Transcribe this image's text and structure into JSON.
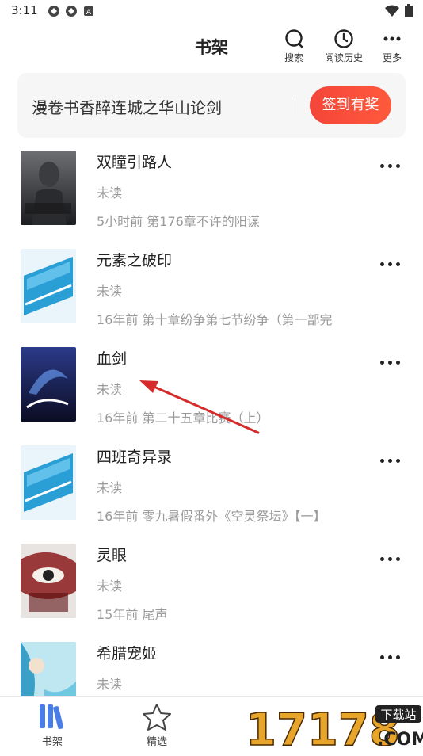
{
  "status_bar": {
    "time": "3:11"
  },
  "header": {
    "title": "书架",
    "actions": [
      {
        "label": "搜索",
        "icon": "search-icon"
      },
      {
        "label": "阅读历史",
        "icon": "clock-icon"
      },
      {
        "label": "更多",
        "icon": "more-icon"
      }
    ]
  },
  "banner": {
    "text": "漫卷书香醉连城之华山论剑",
    "button": "签到有奖"
  },
  "books": [
    {
      "title": "双瞳引路人",
      "status": "未读",
      "update": "5小时前 第176章不许的阳谋"
    },
    {
      "title": "元素之破印",
      "status": "未读",
      "update": "16年前 第十章纷争第七节纷争（第一部完"
    },
    {
      "title": "血剑",
      "status": "未读",
      "update": "16年前 第二十五章比赛（上）"
    },
    {
      "title": "四班奇异录",
      "status": "未读",
      "update": "16年前 零九暑假番外《空灵祭坛》【一】"
    },
    {
      "title": "灵眼",
      "status": "未读",
      "update": "15年前 尾声"
    },
    {
      "title": "希腊宠姬",
      "status": "未读",
      "update": ""
    }
  ],
  "tabbar": {
    "tabs": [
      {
        "label": "书架",
        "icon": "bookshelf-icon"
      },
      {
        "label": "精选",
        "icon": "star-icon"
      }
    ]
  },
  "watermark": {
    "text": "17178",
    "tag": "下载站",
    "suffix": ".COM"
  },
  "colors": {
    "accent": "#f4453a",
    "active_tab": "#4a7de6",
    "arrow": "#d62b2b"
  }
}
